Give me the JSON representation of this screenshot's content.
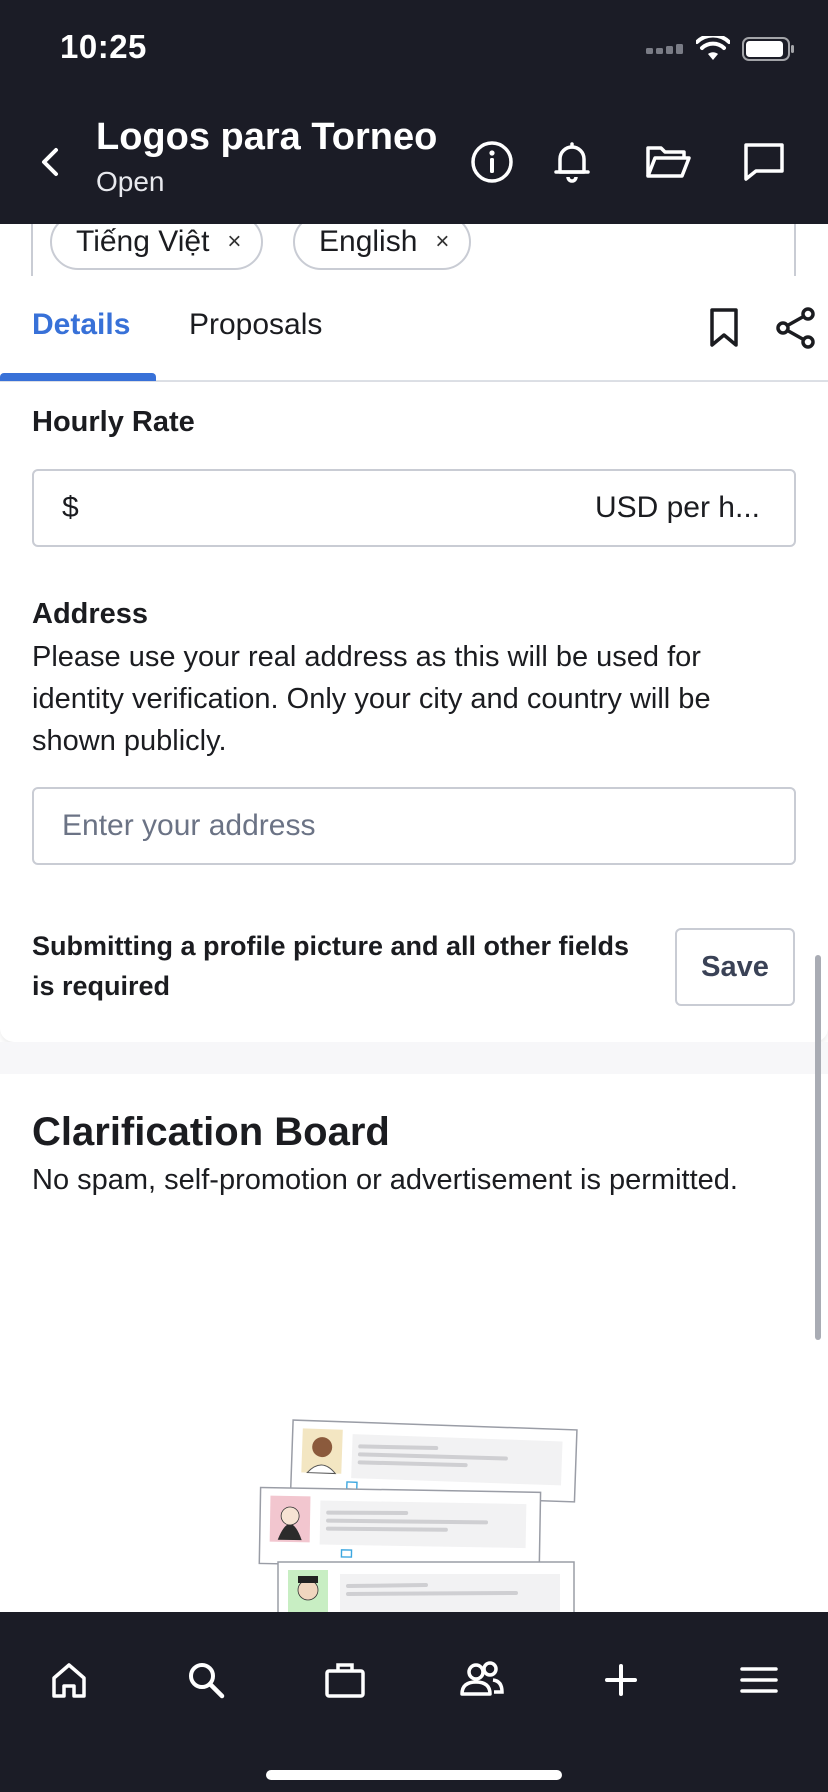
{
  "status_bar": {
    "time": "10:25"
  },
  "header": {
    "title": "Logos para Torneo",
    "status": "Open"
  },
  "languages": [
    {
      "label": "Tiếng Việt",
      "remove": "×"
    },
    {
      "label": "English",
      "remove": "×"
    }
  ],
  "tabs": [
    {
      "label": "Details",
      "active": true
    },
    {
      "label": "Proposals",
      "active": false
    }
  ],
  "form": {
    "hourly_rate": {
      "label": "Hourly Rate",
      "currency_symbol": "$",
      "unit": "USD per h..."
    },
    "address": {
      "label": "Address",
      "description": "Please use your real address as this will be used for identity verification. Only your city and country will be shown publicly.",
      "placeholder": "Enter your address"
    },
    "required_note": "Submitting a profile picture and all other fields is required",
    "save_label": "Save"
  },
  "clarification_board": {
    "title": "Clarification Board",
    "subtitle": "No spam, self-promotion or advertisement is permitted."
  },
  "bottom_nav": [
    {
      "icon": "home-icon"
    },
    {
      "icon": "search-icon"
    },
    {
      "icon": "briefcase-icon"
    },
    {
      "icon": "contacts-icon"
    },
    {
      "icon": "plus-icon"
    },
    {
      "icon": "menu-icon"
    }
  ],
  "colors": {
    "header_bg": "#1b1c26",
    "accent": "#3871d8",
    "border": "#c9ccd4"
  }
}
